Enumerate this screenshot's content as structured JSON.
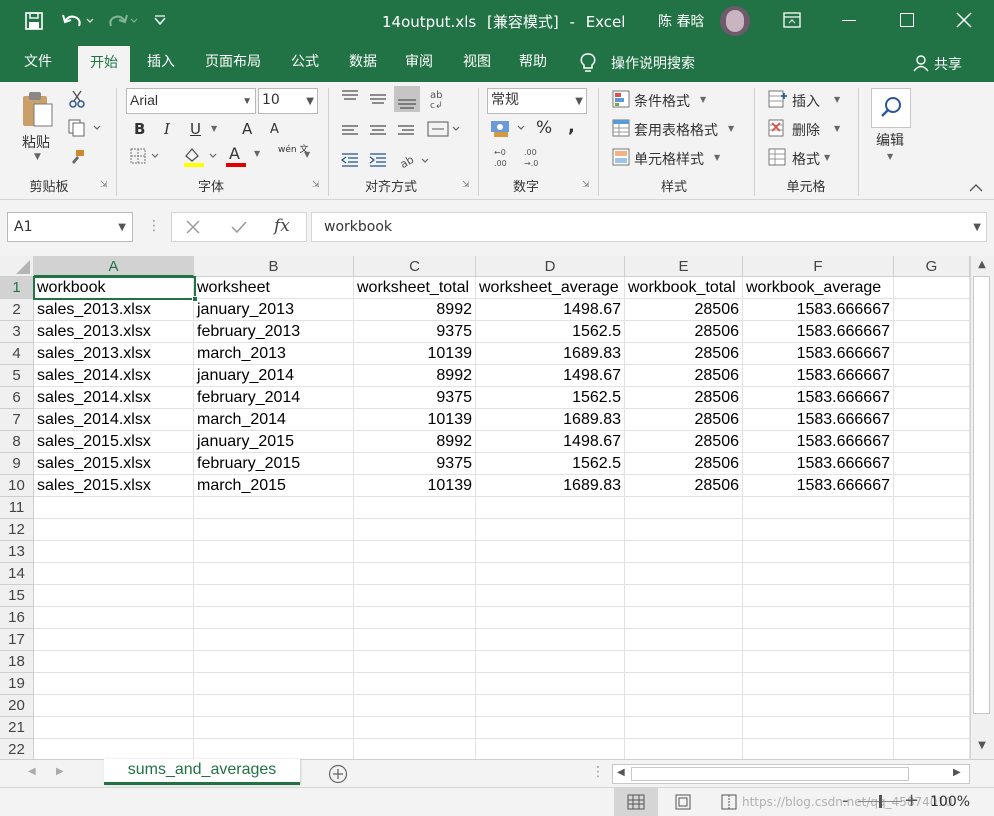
{
  "titlebar": {
    "filename": "14output.xls",
    "mode": "[兼容模式]",
    "sep": "-",
    "app": "Excel",
    "user": "陈 春晗"
  },
  "tabs": [
    "文件",
    "开始",
    "插入",
    "页面布局",
    "公式",
    "数据",
    "审阅",
    "视图",
    "帮助"
  ],
  "tell_me": "操作说明搜索",
  "share": "共享",
  "ribbon": {
    "clipboard": {
      "paste": "粘贴",
      "label": "剪贴板"
    },
    "font": {
      "name": "Arial",
      "size": "10",
      "bold": "B",
      "italic": "I",
      "underline": "U",
      "grow": "A",
      "shrink": "A",
      "phonetic": "wén 文",
      "color_letter": "A",
      "label": "字体"
    },
    "align": {
      "label": "对齐方式"
    },
    "number": {
      "format": "常规",
      "percent": "%",
      "comma": ",",
      "label": "数字"
    },
    "styles": {
      "conditional": "条件格式",
      "table": "套用表格格式",
      "cell": "单元格样式",
      "label": "样式"
    },
    "cells": {
      "insert": "插入",
      "delete": "删除",
      "format": "格式",
      "label": "单元格"
    },
    "edit": {
      "label": "编辑"
    }
  },
  "formula_bar": {
    "name_box": "A1",
    "fx": "fx",
    "value": "workbook"
  },
  "columns": [
    "A",
    "B",
    "C",
    "D",
    "E",
    "F",
    "G"
  ],
  "rows": [
    "1",
    "2",
    "3",
    "4",
    "5",
    "6",
    "7",
    "8",
    "9",
    "10",
    "11",
    "12",
    "13",
    "14",
    "15",
    "16",
    "17",
    "18",
    "19",
    "20",
    "21",
    "22"
  ],
  "cells": [
    [
      "workbook",
      "worksheet",
      "worksheet_total",
      "worksheet_average",
      "workbook_total",
      "workbook_average"
    ],
    [
      "sales_2013.xlsx",
      "january_2013",
      "8992",
      "1498.67",
      "28506",
      "1583.666667"
    ],
    [
      "sales_2013.xlsx",
      "february_2013",
      "9375",
      "1562.5",
      "28506",
      "1583.666667"
    ],
    [
      "sales_2013.xlsx",
      "march_2013",
      "10139",
      "1689.83",
      "28506",
      "1583.666667"
    ],
    [
      "sales_2014.xlsx",
      "january_2014",
      "8992",
      "1498.67",
      "28506",
      "1583.666667"
    ],
    [
      "sales_2014.xlsx",
      "february_2014",
      "9375",
      "1562.5",
      "28506",
      "1583.666667"
    ],
    [
      "sales_2014.xlsx",
      "march_2014",
      "10139",
      "1689.83",
      "28506",
      "1583.666667"
    ],
    [
      "sales_2015.xlsx",
      "january_2015",
      "8992",
      "1498.67",
      "28506",
      "1583.666667"
    ],
    [
      "sales_2015.xlsx",
      "february_2015",
      "9375",
      "1562.5",
      "28506",
      "1583.666667"
    ],
    [
      "sales_2015.xlsx",
      "march_2015",
      "10139",
      "1689.83",
      "28506",
      "1583.666667"
    ]
  ],
  "sheet_tab": "sums_and_averages",
  "status": {
    "watermark": "https://blog.csdn.net/qq_45874010",
    "zoom": "100%",
    "zoom_minus": "-",
    "zoom_plus": "+"
  },
  "colors": {
    "accent": "#217346"
  }
}
